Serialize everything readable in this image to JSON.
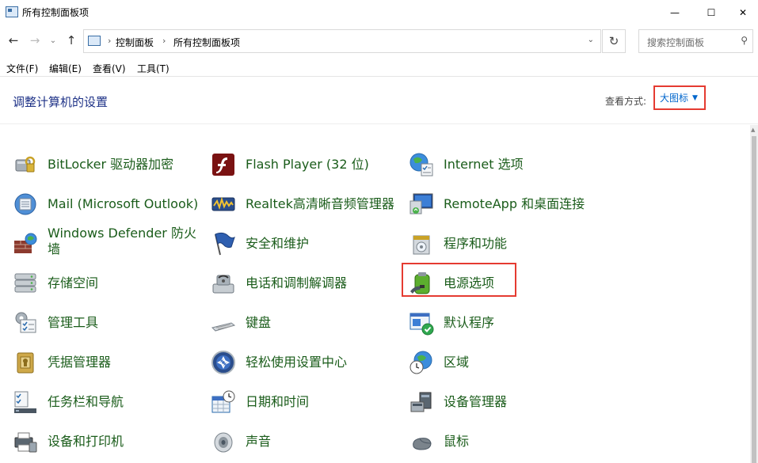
{
  "window": {
    "title": "所有控制面板项",
    "minimize": "—",
    "maximize": "☐",
    "close": "✕"
  },
  "nav": {
    "back": "←",
    "forward": "→",
    "recent": "⌄",
    "up": "↑",
    "breadcrumb": [
      "控制面板",
      "所有控制面板项"
    ],
    "separator": "›",
    "dropdown": "⌄",
    "refresh": "↻",
    "search_placeholder": "搜索控制面板",
    "search_glyph": "⚲"
  },
  "menu": [
    "文件(F)",
    "编辑(E)",
    "查看(V)",
    "工具(T)"
  ],
  "header": {
    "title": "调整计算机的设置",
    "view_label": "查看方式:",
    "view_value": "大图标",
    "view_caret": "▼"
  },
  "items": [
    {
      "label": "BitLocker 驱动器加密",
      "icon": "bitlocker-icon"
    },
    {
      "label": "Flash Player (32 位)",
      "icon": "flash-player-icon"
    },
    {
      "label": "Internet 选项",
      "icon": "internet-options-icon"
    },
    {
      "label": "Mail (Microsoft Outlook)",
      "icon": "mail-icon"
    },
    {
      "label": "Realtek高清晰音频管理器",
      "icon": "realtek-audio-icon"
    },
    {
      "label": "RemoteApp 和桌面连接",
      "icon": "remoteapp-icon"
    },
    {
      "label": "Windows Defender 防火墙",
      "icon": "firewall-icon"
    },
    {
      "label": "安全和维护",
      "icon": "security-flag-icon"
    },
    {
      "label": "程序和功能",
      "icon": "programs-icon"
    },
    {
      "label": "存储空间",
      "icon": "storage-spaces-icon"
    },
    {
      "label": "电话和调制解调器",
      "icon": "phone-modem-icon"
    },
    {
      "label": "电源选项",
      "icon": "power-options-icon"
    },
    {
      "label": "管理工具",
      "icon": "admin-tools-icon"
    },
    {
      "label": "键盘",
      "icon": "keyboard-icon"
    },
    {
      "label": "默认程序",
      "icon": "default-programs-icon"
    },
    {
      "label": "凭据管理器",
      "icon": "credential-manager-icon"
    },
    {
      "label": "轻松使用设置中心",
      "icon": "ease-of-access-icon"
    },
    {
      "label": "区域",
      "icon": "region-icon"
    },
    {
      "label": "任务栏和导航",
      "icon": "taskbar-icon"
    },
    {
      "label": "日期和时间",
      "icon": "date-time-icon"
    },
    {
      "label": "设备管理器",
      "icon": "device-manager-icon"
    },
    {
      "label": "设备和打印机",
      "icon": "devices-printers-icon"
    },
    {
      "label": "声音",
      "icon": "sound-icon"
    },
    {
      "label": "鼠标",
      "icon": "mouse-icon"
    }
  ],
  "colors": {
    "link_green": "#1a5c1a",
    "title_blue": "#1e3287",
    "highlight_red": "#e53b31",
    "view_blue": "#0066cc"
  }
}
